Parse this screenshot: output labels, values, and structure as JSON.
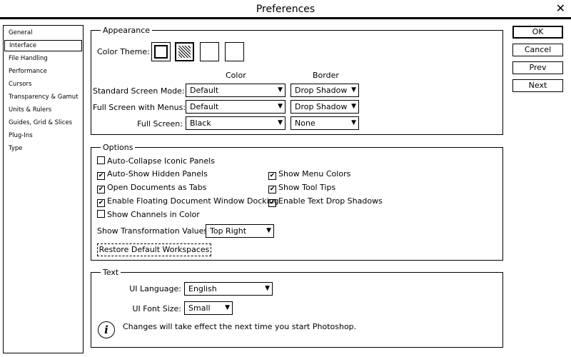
{
  "window": {
    "title": "Preferences"
  },
  "sidebar": {
    "items": [
      {
        "label": "General"
      },
      {
        "label": "Interface"
      },
      {
        "label": "File Handling"
      },
      {
        "label": "Performance"
      },
      {
        "label": "Cursors"
      },
      {
        "label": "Transparency & Gamut"
      },
      {
        "label": "Units & Rulers"
      },
      {
        "label": "Guides, Grid & Slices"
      },
      {
        "label": "Plug-Ins"
      },
      {
        "label": "Type"
      }
    ],
    "selected": "Interface"
  },
  "appearance": {
    "title": "Appearance",
    "color_theme_label": "Color Theme:",
    "col_color": "Color",
    "col_border": "Border",
    "rows": [
      {
        "label": "Standard Screen Mode:",
        "color": "Default",
        "border": "Drop Shadow"
      },
      {
        "label": "Full Screen with Menus:",
        "color": "Default",
        "border": "Drop Shadow"
      },
      {
        "label": "Full Screen:",
        "color": "Black",
        "border": "None"
      }
    ]
  },
  "options": {
    "title": "Options",
    "checks": [
      {
        "label": "Auto-Collapse Iconic Panels",
        "checked": false
      },
      {
        "label": "Auto-Show Hidden Panels",
        "checked": true
      },
      {
        "label": "Open Documents as Tabs",
        "checked": true
      },
      {
        "label": "Enable Floating Document Window Docking",
        "checked": true
      },
      {
        "label": "Show Channels in Color",
        "checked": false
      },
      {
        "label": "Show Menu Colors",
        "checked": true
      },
      {
        "label": "Show Tool Tips",
        "checked": true
      },
      {
        "label": "Enable Text Drop Shadows",
        "checked": true
      }
    ],
    "transform_label": "Show Transformation Values:",
    "transform_value": "Top Right",
    "restore_label": "Restore Default Workspaces"
  },
  "text": {
    "title": "Text",
    "ui_language_label": "UI Language:",
    "ui_language_value": "English",
    "ui_font_size_label": "UI Font Size:",
    "ui_font_size_value": "Small",
    "info_message": "Changes will take effect the next time you start Photoshop."
  },
  "buttons": {
    "ok": "OK",
    "cancel": "Cancel",
    "prev": "Prev",
    "next": "Next"
  },
  "icons": {
    "close": "close-icon",
    "dropdown": "chevron-down-icon",
    "info": "info-icon",
    "check": "checkmark-icon"
  }
}
